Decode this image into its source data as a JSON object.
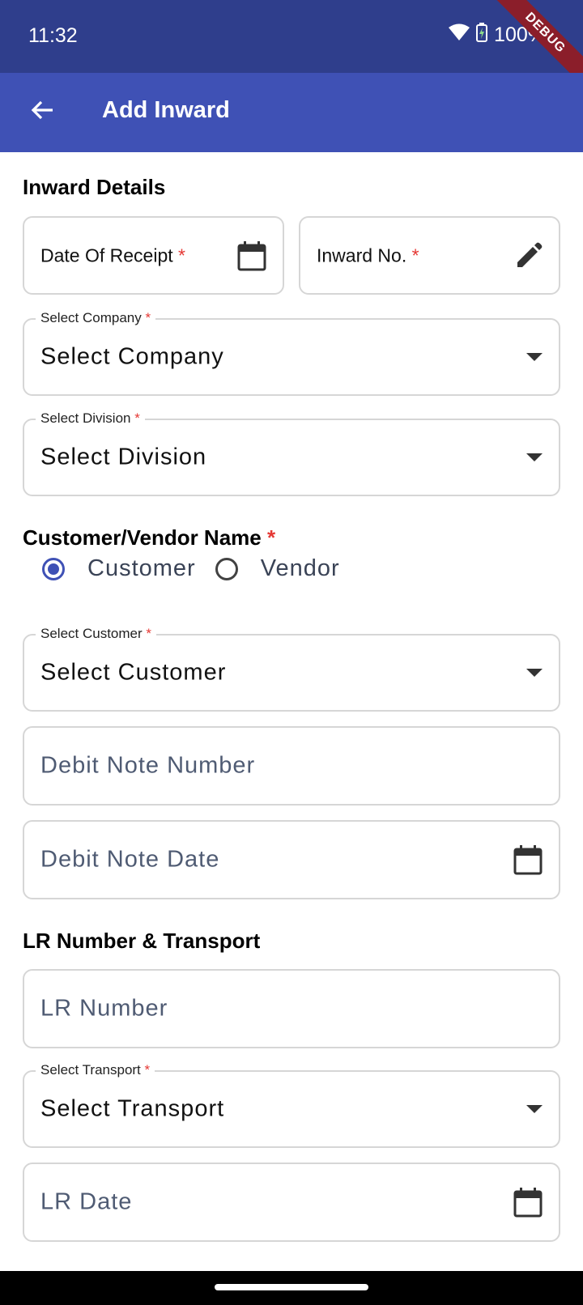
{
  "status_bar": {
    "time": "11:32",
    "battery": "100%",
    "debug_label": "DEBUG"
  },
  "app_bar": {
    "title": "Add Inward",
    "back_icon": "arrow-left-icon"
  },
  "inward_details": {
    "heading": "Inward Details",
    "date_of_receipt": {
      "label": "Date Of Receipt",
      "required_mark": "*",
      "icon": "calendar-icon"
    },
    "inward_no": {
      "label": "Inward No.",
      "required_mark": "*",
      "icon": "pencil-icon"
    },
    "company": {
      "legend": "Select Company",
      "required_mark": "*",
      "value": "Select Company",
      "icon": "dropdown-arrow-icon"
    },
    "division": {
      "legend": "Select Division",
      "required_mark": "*",
      "value": "Select Division",
      "icon": "dropdown-arrow-icon"
    }
  },
  "customer_vendor": {
    "heading": "Customer/Vendor Name",
    "required_mark": "*",
    "options": [
      {
        "label": "Customer",
        "selected": true
      },
      {
        "label": "Vendor",
        "selected": false
      }
    ],
    "customer": {
      "legend": "Select Customer",
      "required_mark": "*",
      "value": "Select Customer",
      "icon": "dropdown-arrow-icon"
    },
    "debit_note_number": {
      "placeholder": "Debit Note Number"
    },
    "debit_note_date": {
      "placeholder": "Debit Note Date",
      "icon": "calendar-icon"
    }
  },
  "lr_transport": {
    "heading": "LR Number & Transport",
    "lr_number": {
      "placeholder": "LR Number"
    },
    "transport": {
      "legend": "Select Transport",
      "required_mark": "*",
      "value": "Select Transport",
      "icon": "dropdown-arrow-icon"
    },
    "lr_date": {
      "placeholder": "LR Date",
      "icon": "calendar-icon"
    }
  },
  "colors": {
    "status_bar": "#2f3e8c",
    "app_bar": "#3f51b5",
    "accent": "#3f51b5",
    "required": "#e53935",
    "border": "#d6d6d6"
  }
}
